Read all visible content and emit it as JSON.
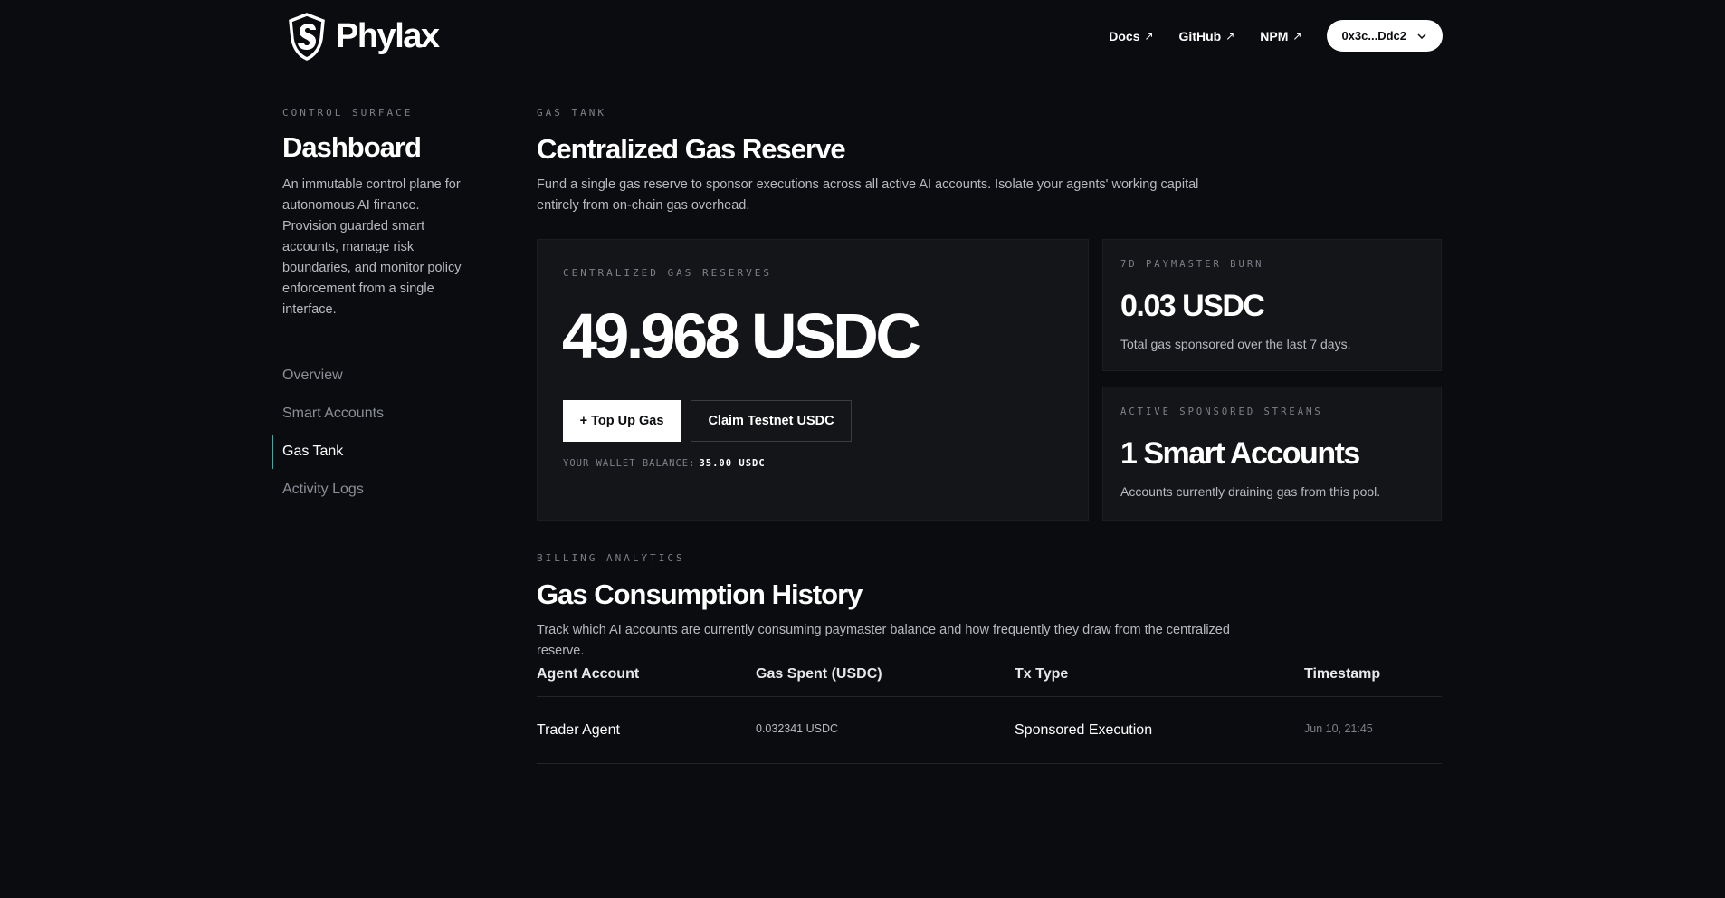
{
  "header": {
    "brand": "Phylax",
    "nav": [
      {
        "label": "Docs",
        "arrow": "↗"
      },
      {
        "label": "GitHub",
        "arrow": "↗"
      },
      {
        "label": "NPM",
        "arrow": "↗"
      }
    ],
    "wallet": "0x3c...Ddc2"
  },
  "sidebar": {
    "eyebrow": "CONTROL SURFACE",
    "title": "Dashboard",
    "description": "An immutable control plane for autonomous AI finance. Provision guarded smart accounts, manage risk boundaries, and monitor policy enforcement from a single interface.",
    "items": [
      {
        "label": "Overview"
      },
      {
        "label": "Smart Accounts"
      },
      {
        "label": "Gas Tank"
      },
      {
        "label": "Activity Logs"
      }
    ]
  },
  "main": {
    "eyebrow": "GAS TANK",
    "title": "Centralized Gas Reserve",
    "description": "Fund a single gas reserve to sponsor executions across all active AI accounts. Isolate your agents' working capital entirely from on-chain gas overhead.",
    "reserve_card": {
      "eyebrow": "CENTRALIZED GAS RESERVES",
      "value": "49.968 USDC",
      "top_up_label": "+ Top Up Gas",
      "claim_label": "Claim Testnet USDC",
      "wallet_balance_label": "YOUR WALLET BALANCE:",
      "wallet_balance_value": "35.00 USDC"
    },
    "burn_card": {
      "eyebrow": "7D PAYMASTER BURN",
      "value": "0.03 USDC",
      "note": "Total gas sponsored over the last 7 days."
    },
    "streams_card": {
      "eyebrow": "ACTIVE SPONSORED STREAMS",
      "value": "1 Smart Accounts",
      "note": "Accounts currently draining gas from this pool."
    },
    "billing": {
      "eyebrow": "BILLING ANALYTICS",
      "title": "Gas Consumption History",
      "description": "Track which AI accounts are currently consuming paymaster balance and how frequently they draw from the centralized reserve."
    },
    "table": {
      "headers": [
        "Agent Account",
        "Gas Spent (USDC)",
        "Tx Type",
        "Timestamp"
      ],
      "rows": [
        {
          "agent": "Trader Agent",
          "gas": "0.032341 USDC",
          "type": "Sponsored Execution",
          "time": "Jun 10, 21:45"
        }
      ]
    }
  },
  "colors": {
    "background": "#0b0c0f",
    "card": "#141518",
    "accent": "#4ea3a0"
  }
}
